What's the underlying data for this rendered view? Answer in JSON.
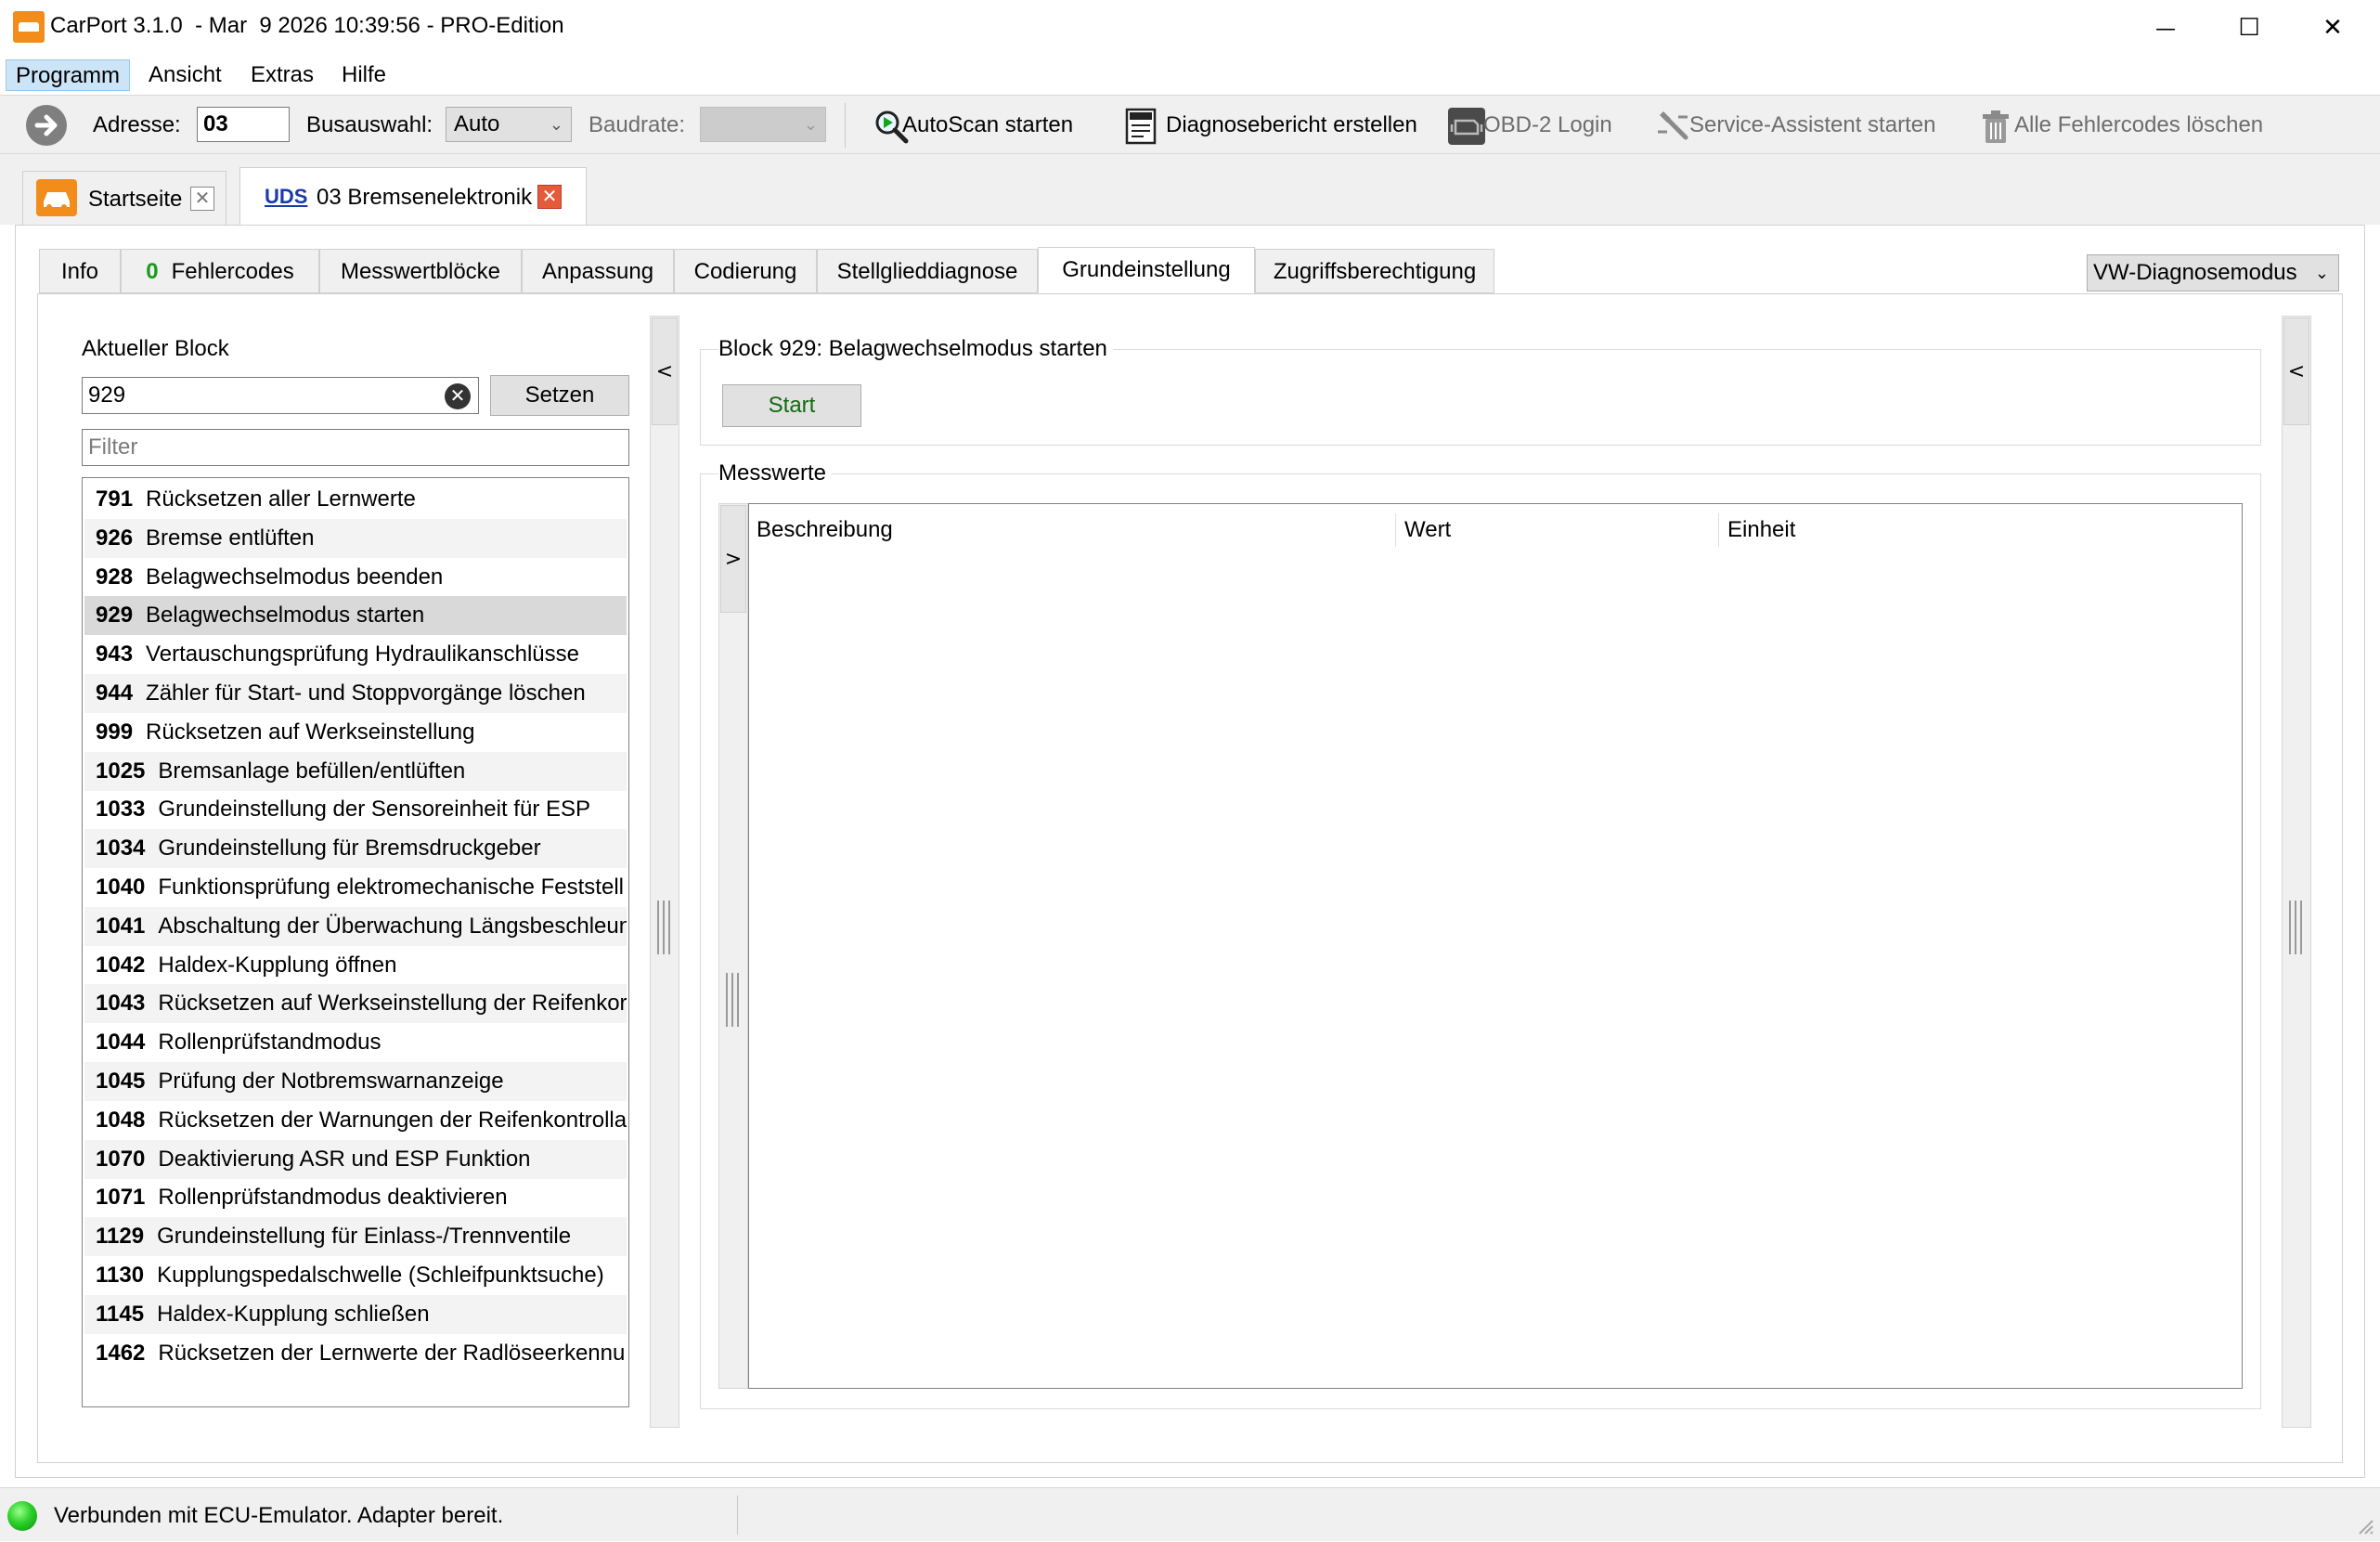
{
  "window": {
    "title": "CarPort 3.1.0  - Mar  9 2026 10:39:56 - PRO-Edition",
    "minimize_glyph": "—",
    "maximize_glyph": "☐",
    "close_glyph": "✕"
  },
  "menu": [
    "Programm",
    "Ansicht",
    "Extras",
    "Hilfe"
  ],
  "toolbar": {
    "address_label": "Adresse:",
    "address_value": "03",
    "bus_label": "Busauswahl:",
    "bus_value": "Auto",
    "baud_label": "Baudrate:",
    "baud_value": "",
    "autoscan_label": "AutoScan starten",
    "report_label": "Diagnosebericht erstellen",
    "obd_login_label": "OBD-2 Login",
    "service_label": "Service-Assistent starten",
    "clear_dtc_label": "Alle Fehlercodes löschen"
  },
  "doc_tabs": [
    {
      "label": "Startseite",
      "icon": "car-icon"
    },
    {
      "badge": "UDS",
      "label": "03 Bremsenelektronik"
    }
  ],
  "inner_tabs": {
    "info": "Info",
    "fault_count": "0",
    "faults": "Fehlercodes",
    "measurement_blocks": "Messwertblöcke",
    "adaptation": "Anpassung",
    "coding": "Codierung",
    "actuator": "Stellglieddiagnose",
    "basic_setting": "Grundeinstellung",
    "access": "Zugriffsberechtigung"
  },
  "diag_mode": "VW-Diagnosemodus",
  "left_panel": {
    "current_block_label": "Aktueller Block",
    "block_value": "929",
    "set_button": "Setzen",
    "filter_placeholder": "Filter",
    "collapse_glyph": "<"
  },
  "blocks": [
    {
      "id": "791",
      "name": "Rücksetzen aller Lernwerte"
    },
    {
      "id": "926",
      "name": "Bremse entlüften"
    },
    {
      "id": "928",
      "name": "Belagwechselmodus beenden"
    },
    {
      "id": "929",
      "name": "Belagwechselmodus starten",
      "selected": true
    },
    {
      "id": "943",
      "name": "Vertauschungsprüfung Hydraulikanschlüsse"
    },
    {
      "id": "944",
      "name": "Zähler für Start- und Stoppvorgänge löschen"
    },
    {
      "id": "999",
      "name": "Rücksetzen auf Werkseinstellung"
    },
    {
      "id": "1025",
      "name": "Bremsanlage befüllen/entlüften"
    },
    {
      "id": "1033",
      "name": "Grundeinstellung der Sensoreinheit für ESP"
    },
    {
      "id": "1034",
      "name": "Grundeinstellung für Bremsdruckgeber"
    },
    {
      "id": "1040",
      "name": "Funktionsprüfung elektromechanische Feststell"
    },
    {
      "id": "1041",
      "name": "Abschaltung der Überwachung Längsbeschleun"
    },
    {
      "id": "1042",
      "name": "Haldex-Kupplung öffnen"
    },
    {
      "id": "1043",
      "name": "Rücksetzen auf Werkseinstellung der Reifenkor"
    },
    {
      "id": "1044",
      "name": "Rollenprüfstandmodus"
    },
    {
      "id": "1045",
      "name": "Prüfung der Notbremswarnanzeige"
    },
    {
      "id": "1048",
      "name": "Rücksetzen der Warnungen der Reifenkontrolla"
    },
    {
      "id": "1070",
      "name": "Deaktivierung ASR und ESP Funktion"
    },
    {
      "id": "1071",
      "name": "Rollenprüfstandmodus deaktivieren"
    },
    {
      "id": "1129",
      "name": "Grundeinstellung für Einlass-/Trennventile"
    },
    {
      "id": "1130",
      "name": "Kupplungspedalschwelle (Schleifpunktsuche)"
    },
    {
      "id": "1145",
      "name": "Haldex-Kupplung schließen"
    },
    {
      "id": "1462",
      "name": "Rücksetzen der Lernwerte der Radlöseerkennu"
    }
  ],
  "right_panel": {
    "block_title": "Block 929: Belagwechselmodus starten",
    "start_button": "Start",
    "measurements_title": "Messwerte",
    "expand_glyph": ">",
    "collapse_glyph": "<",
    "columns": [
      "Beschreibung",
      "Wert",
      "Einheit"
    ]
  },
  "status": {
    "text": "Verbunden mit ECU-Emulator. Adapter bereit.",
    "led_color": "#2bd12b"
  },
  "colors": {
    "brand_orange": "#f28c1b",
    "start_green": "#106b10",
    "fault_count_green": "#1a9a1a",
    "selected_row": "#d9d9d9"
  }
}
